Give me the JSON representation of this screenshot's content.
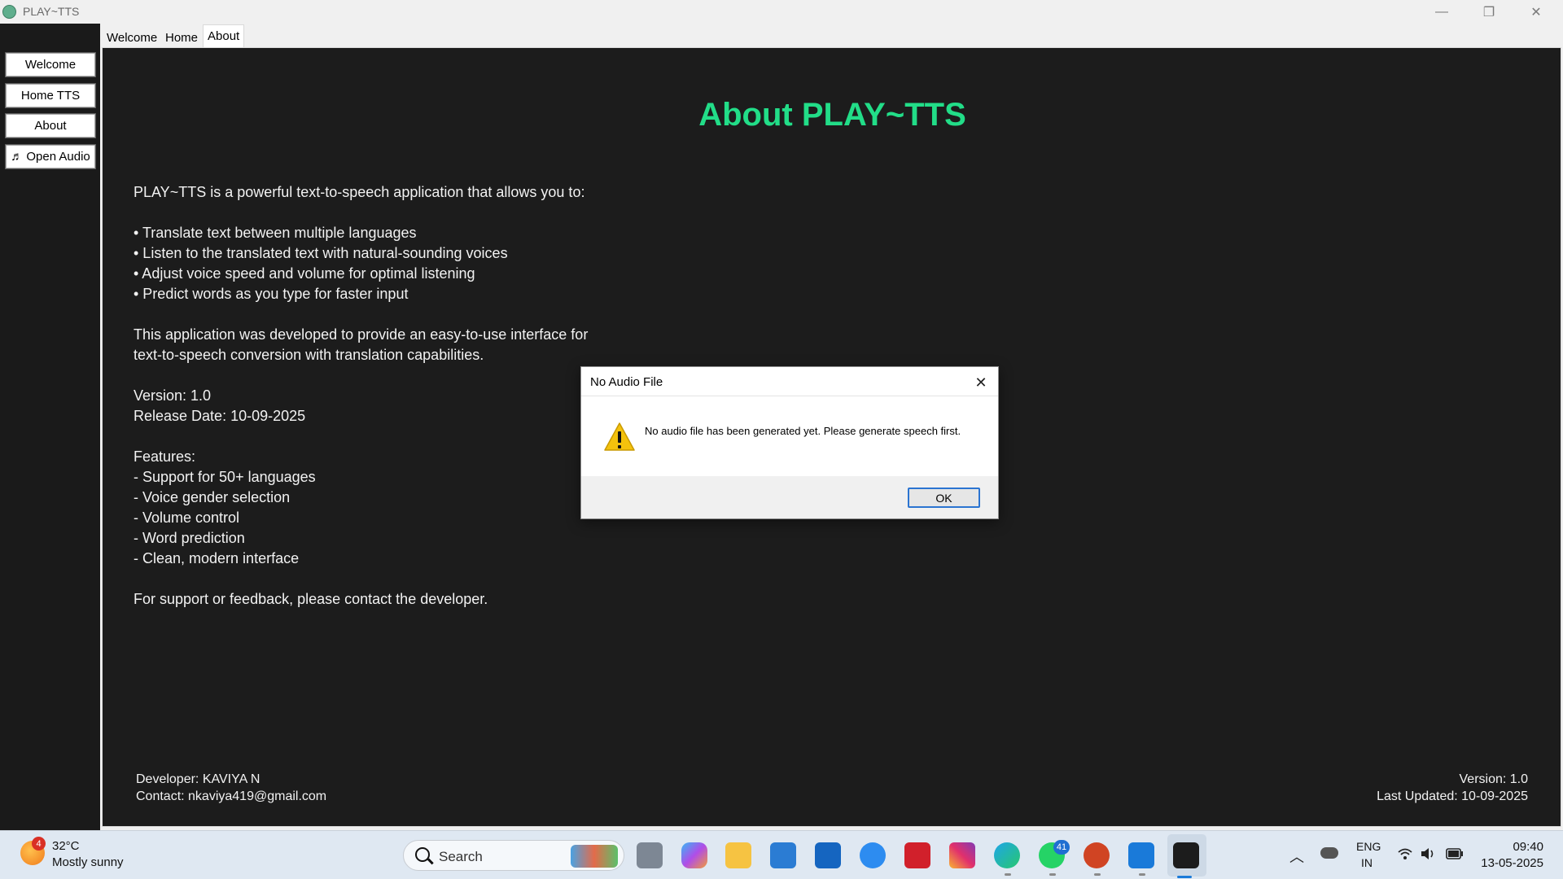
{
  "window": {
    "title": "PLAY~TTS",
    "minimize_glyph": "—",
    "maximize_glyph": "❐",
    "close_glyph": "✕"
  },
  "sidebar": {
    "buttons": [
      {
        "label": "Welcome"
      },
      {
        "label": "Home TTS"
      },
      {
        "label": "About"
      },
      {
        "label": "♬ Open Audio"
      }
    ]
  },
  "tabs": [
    {
      "label": "Welcome"
    },
    {
      "label": "Home"
    },
    {
      "label": "About",
      "selected": true
    }
  ],
  "about": {
    "heading": "About PLAY~TTS",
    "heading_color": "#22dd88",
    "body": "PLAY~TTS is a powerful text-to-speech application that allows you to:\n\n• Translate text between multiple languages\n• Listen to the translated text with natural-sounding voices\n• Adjust voice speed and volume for optimal listening\n• Predict words as you type for faster input\n\nThis application was developed to provide an easy-to-use interface for\ntext-to-speech conversion with translation capabilities.\n\nVersion: 1.0\nRelease Date: 10-09-2025\n\nFeatures:\n- Support for 50+ languages\n- Voice gender selection\n- Volume control\n- Word prediction\n- Clean, modern interface\n\nFor support or feedback, please contact the developer.",
    "developer": "Developer: KAVIYA N",
    "contact": "Contact: nkaviya419@gmail.com",
    "version": "Version: 1.0",
    "last_updated": "Last Updated: 10-09-2025"
  },
  "dialog": {
    "title": "No Audio File",
    "close_glyph": "✕",
    "icon": "warning-icon",
    "message": "No audio file has been generated yet. Please generate speech first.",
    "ok_label": "OK"
  },
  "taskbar": {
    "weather": {
      "temp": "32°C",
      "desc": "Mostly sunny",
      "badge": "4"
    },
    "search_label": "Search",
    "pinned": [
      {
        "name": "task-view-icon"
      },
      {
        "name": "copilot-icon"
      },
      {
        "name": "file-explorer-icon"
      },
      {
        "name": "microsoft-store-icon"
      },
      {
        "name": "myhp-icon"
      },
      {
        "name": "get-help-icon"
      },
      {
        "name": "mcafee-icon"
      },
      {
        "name": "instagram-icon"
      },
      {
        "name": "edge-icon"
      },
      {
        "name": "whatsapp-icon",
        "badge": "41"
      },
      {
        "name": "powerpoint-icon"
      },
      {
        "name": "vscode-icon"
      },
      {
        "name": "play-tts-icon"
      }
    ],
    "tray": {
      "lang_line1": "ENG",
      "lang_line2": "IN",
      "time": "09:40",
      "date": "13-05-2025"
    }
  }
}
